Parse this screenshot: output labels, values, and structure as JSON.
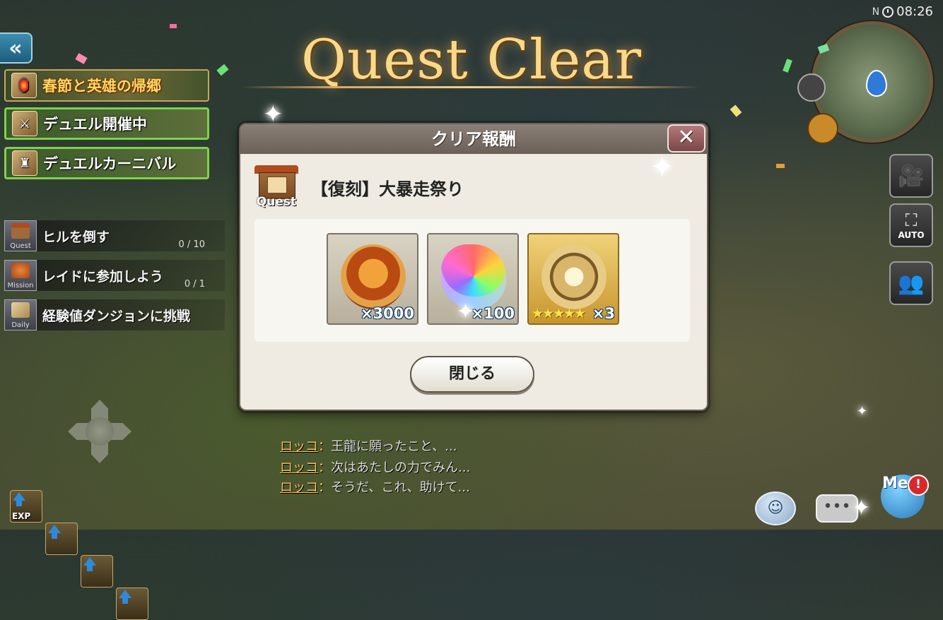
{
  "status_bar": {
    "signal": "N",
    "time": "08:26"
  },
  "title": "Quest Clear",
  "left_panel": {
    "back_label": "«",
    "banners": [
      {
        "label": "春節と英雄の帰郷"
      },
      {
        "label": "デュエル開催中"
      },
      {
        "label": "デュエルカーニバル"
      }
    ],
    "missions": [
      {
        "icon_caption": "Quest",
        "text": "ヒルを倒す",
        "progress": "0 / 10"
      },
      {
        "icon_caption": "Mission",
        "text": "レイドに参加しよう",
        "progress": "0 / 1"
      },
      {
        "icon_caption": "Daily",
        "text": "経験値ダンジョンに挑戦",
        "progress": ""
      }
    ],
    "boosters": [
      {
        "label": "EXP"
      },
      {
        "label": ""
      },
      {
        "label": ""
      },
      {
        "label": ""
      }
    ]
  },
  "dialog": {
    "header": "クリア報酬",
    "close_glyph": "✕",
    "quest_icon_caption": "Quest",
    "quest_name": "【復刻】大暴走祭り",
    "rewards": [
      {
        "icon": "gold-knot-medal-icon",
        "quantity": "×3000",
        "stars": ""
      },
      {
        "icon": "rainbow-crystal-icon",
        "quantity": "×100",
        "stars": ""
      },
      {
        "icon": "golden-orb-pendant-icon",
        "quantity": "×3",
        "stars": "★★★★★"
      }
    ],
    "close_button": "閉じる"
  },
  "chat_log": [
    {
      "speaker": "ロッコ",
      "separator": "：",
      "message": "王龍に願ったこと、..."
    },
    {
      "speaker": "ロッコ",
      "separator": "：",
      "message": "次はあたしの力でみん..."
    },
    {
      "speaker": "ロッコ",
      "separator": "：",
      "message": "そうだ、これ、助けて..."
    }
  ],
  "right_panel": {
    "auto_label": "AUTO",
    "me_label": "Me",
    "alert_glyph": "!"
  },
  "colors": {
    "accent_gold": "#f7d98c",
    "dialog_bg": "#efebe2",
    "close_red": "#7a4646",
    "quantity_outline": "#103a66",
    "speaker": "#ffc35a",
    "banner_green": "#7ed14b"
  }
}
